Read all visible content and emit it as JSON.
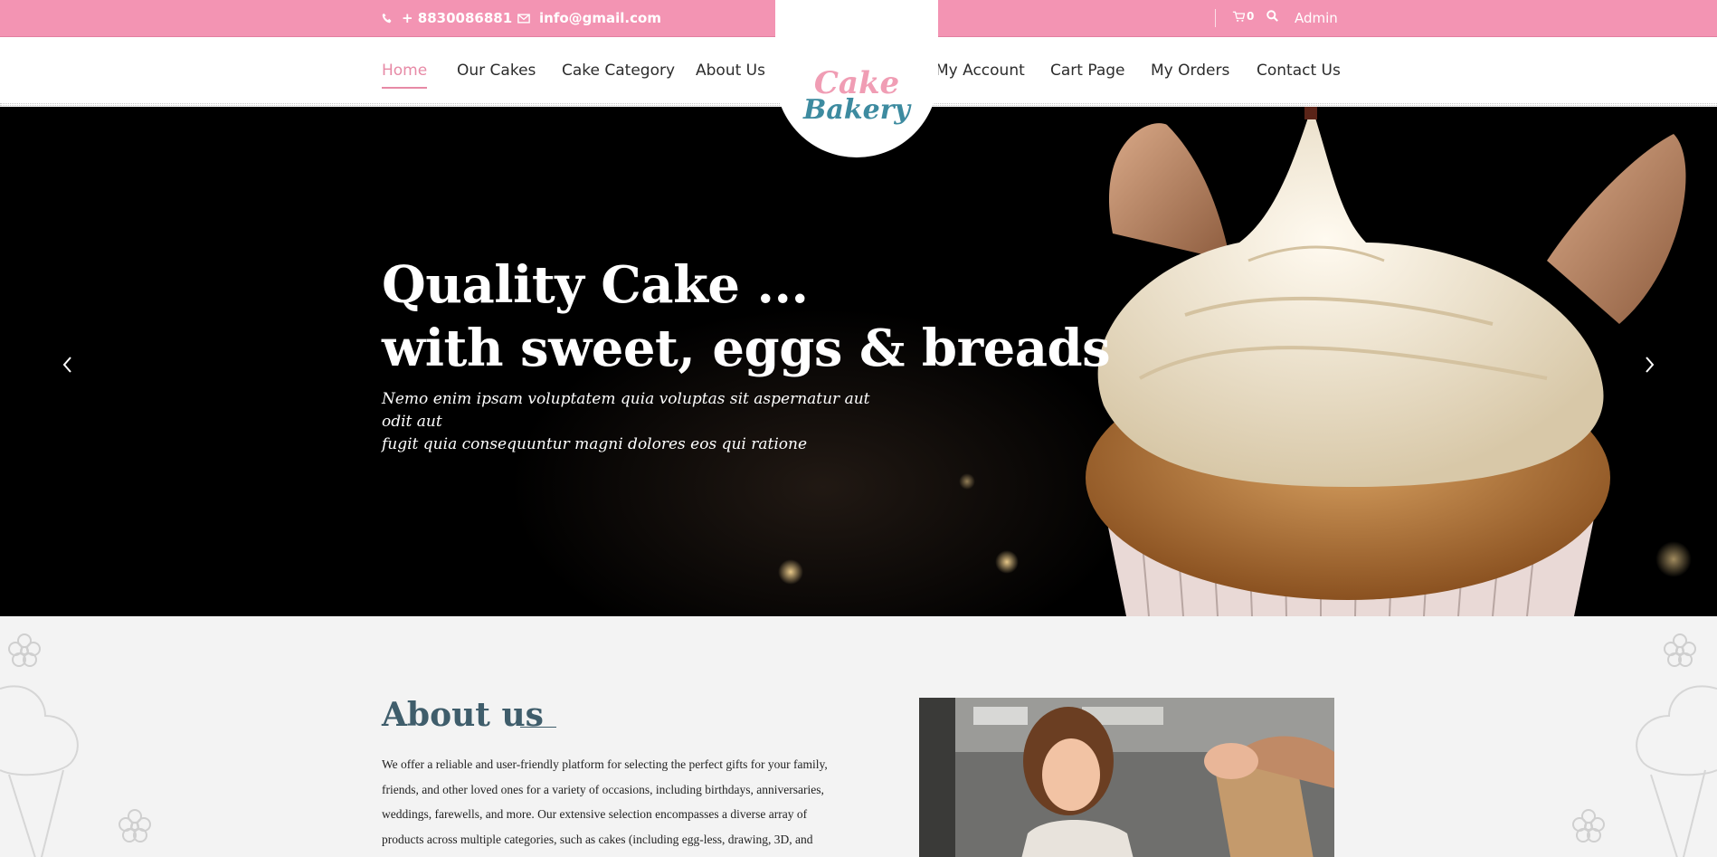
{
  "topbar": {
    "phone": "+ 8830086881",
    "email": "info@gmail.com",
    "cart_count": "0",
    "admin": "Admin",
    "icons": [
      "phone-icon",
      "envelope-icon",
      "cart-icon",
      "search-icon"
    ]
  },
  "nav": {
    "left": [
      "Home",
      "Our Cakes",
      "Cake Category",
      "About Us"
    ],
    "right": [
      "My Account",
      "Cart Page",
      "My Orders",
      "Contact Us"
    ],
    "active": "Home",
    "active_color": "#e78aa6"
  },
  "logo": {
    "line1": "Cake",
    "line2": "Bakery",
    "color1": "#f09db4",
    "color2": "#3d8ba0"
  },
  "hero": {
    "title_line1": "Quality Cake ...",
    "title_line2": "with sweet, eggs & breads",
    "subtitle_line1": "Nemo enim ipsam voluptatem quia voluptas sit aspernatur aut odit aut",
    "subtitle_line2": "fugit quia consequuntur magni dolores eos qui ratione",
    "icons": [
      "chevron-left-icon",
      "chevron-right-icon"
    ]
  },
  "about": {
    "heading": "About us",
    "body": "We offer a reliable and user-friendly platform for selecting the perfect gifts for your family, friends, and other loved ones for a variety of occasions, including birthdays, anniversaries, weddings, farewells, and more. Our extensive selection encompasses a diverse array of products across multiple categories, such as cakes (including egg-less, drawing, 3D, and"
  },
  "colors": {
    "topbar": "#f394b3",
    "heading": "#3f5d6b"
  }
}
